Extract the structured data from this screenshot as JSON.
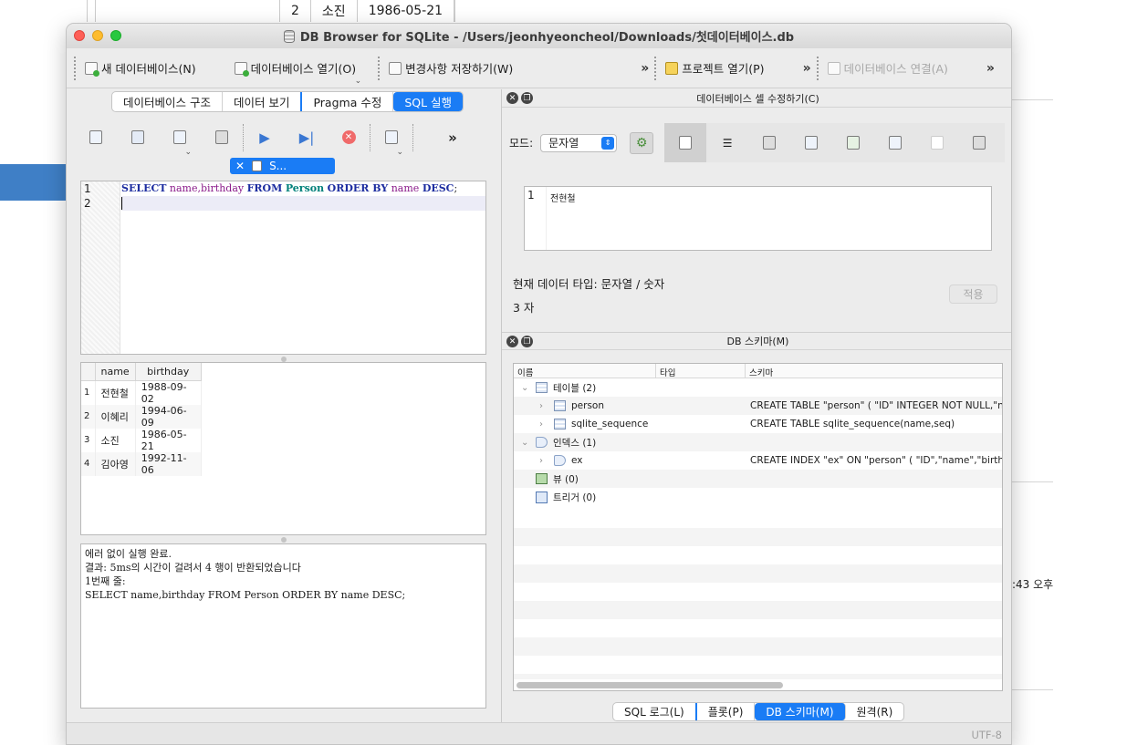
{
  "background": {
    "row_num": "2",
    "row_name": "소진",
    "row_date": "1986-05-21",
    "time_fragment": ":43 오후"
  },
  "window": {
    "title": "DB Browser for SQLite - /Users/jeonhyeoncheol/Downloads/첫데이터베이스.db"
  },
  "toolbar": {
    "new_db": "새 데이터베이스(N)",
    "open_db": "데이터베이스 열기(O)",
    "write_changes": "변경사항 저장하기(W)",
    "more": "»",
    "open_project": "프로젝트 열기(P)",
    "attach_db": "데이터베이스 연결(A)"
  },
  "main_tabs": {
    "structure": "데이터베이스 구조",
    "browse": "데이터 보기",
    "pragma": "Pragma 수정",
    "sql": "SQL 실행"
  },
  "editor": {
    "more": "»",
    "tab_close": "✕",
    "tab_label": "S...",
    "line1": "1",
    "line2": "2",
    "code": {
      "select": "SELECT",
      "cols": "name,birthday",
      "from": "FROM",
      "table": "Person",
      "order": "ORDER BY",
      "col": "name",
      "desc": "DESC",
      "semi": ";"
    }
  },
  "results": {
    "columns": [
      "name",
      "birthday"
    ],
    "rows": [
      {
        "n": "1",
        "name": "전현철",
        "birthday": "1988-09-02"
      },
      {
        "n": "2",
        "name": "이혜리",
        "birthday": "1994-06-09"
      },
      {
        "n": "3",
        "name": "소진",
        "birthday": "1986-05-21"
      },
      {
        "n": "4",
        "name": "김아영",
        "birthday": "1992-11-06"
      }
    ]
  },
  "message": {
    "line1": "에러 없이 실행 완료.",
    "line2": "결과: 5ms의 시간이 걸려서 4 행이 반환되었습니다",
    "line3": "1번째 줄:",
    "line4": "SELECT name,birthday FROM Person ORDER BY name DESC;"
  },
  "cell_editor": {
    "title": "데이터베이스 셀 수정하기(C)",
    "mode_label": "모드:",
    "mode_value": "문자열",
    "line_no": "1",
    "cell_value": "전현철",
    "data_type": "현재 데이터 타입: 문자열 / 숫자",
    "size": "3 자",
    "apply": "적용"
  },
  "schema": {
    "title": "DB 스키마(M)",
    "col_name": "이름",
    "col_type": "타입",
    "col_schema": "스키마",
    "tables_label": "테이블 (2)",
    "person": "person",
    "person_sql": "CREATE TABLE \"person\" ( \"ID\" INTEGER NOT NULL,\"nam",
    "seq": "sqlite_sequence",
    "seq_sql": "CREATE TABLE sqlite_sequence(name,seq)",
    "indexes_label": "인덱스 (1)",
    "ex": "ex",
    "ex_sql": "CREATE INDEX \"ex\" ON \"person\" ( \"ID\",\"name\",\"birthda",
    "views_label": "뷰 (0)",
    "triggers_label": "트리거 (0)"
  },
  "bottom_tabs": {
    "sql_log": "SQL 로그(L)",
    "plot": "플롯(P)",
    "schema": "DB 스키마(M)",
    "remote": "원격(R)"
  },
  "status": {
    "encoding": "UTF-8"
  },
  "colors": {
    "accent": "#1a7cf5"
  }
}
